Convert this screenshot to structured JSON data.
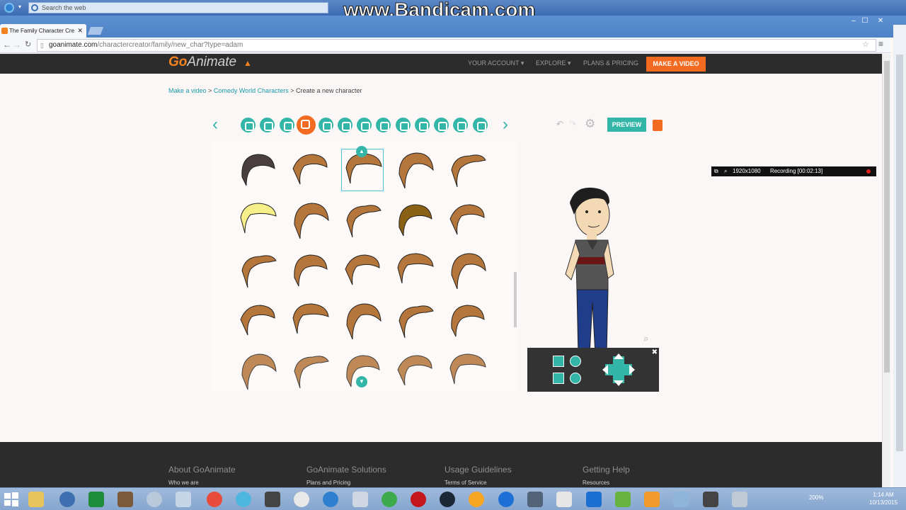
{
  "browser": {
    "search_placeholder": "Search the web",
    "tab_title": "The Family Character Cre",
    "url_domain": "goanimate.com",
    "url_path": "/charactercreator/family/new_char?type=adam"
  },
  "watermark": "www.Bandicam.com",
  "header": {
    "logo_go": "Go",
    "logo_animate": "Animate",
    "nav_account": "YOUR ACCOUNT ▾",
    "nav_explore": "EXPLORE ▾",
    "nav_plans": "PLANS & PRICING",
    "make_video": "MAKE A VIDEO"
  },
  "breadcrumb": {
    "item1": "Make a video",
    "item2": "Comedy World Characters",
    "current": "Create a new character",
    "sep": ">"
  },
  "toolbar": {
    "preview_label": "PREVIEW",
    "icons": [
      "shirt-icon",
      "pants-icon",
      "face-icon",
      "hair-icon",
      "head-icon",
      "mouth-icon",
      "ear-icon",
      "nose-icon",
      "eyes-icon",
      "eyebrows-icon",
      "body-icon",
      "glasses-icon",
      "accessory-icon"
    ]
  },
  "recording": {
    "resolution": "1920x1080",
    "status": "Recording [00:02:13]"
  },
  "footer": {
    "col1_title": "About GoAnimate",
    "col1_link": "Who we are",
    "col2_title": "GoAnimate Solutions",
    "col2_link": "Plans and Pricing",
    "col3_title": "Usage Guidelines",
    "col3_link": "Terms of Service",
    "col4_title": "Getting Help",
    "col4_link": "Resources"
  },
  "taskbar": {
    "zoom": "200%",
    "time": "1:14 AM",
    "date": "10/13/2015"
  },
  "colors": {
    "teal": "#33b6a8",
    "orange": "#f26b21",
    "hair_brown": "#b5763c",
    "hair_dark": "#4a3f3f",
    "hair_blonde": "#f7f08a"
  }
}
